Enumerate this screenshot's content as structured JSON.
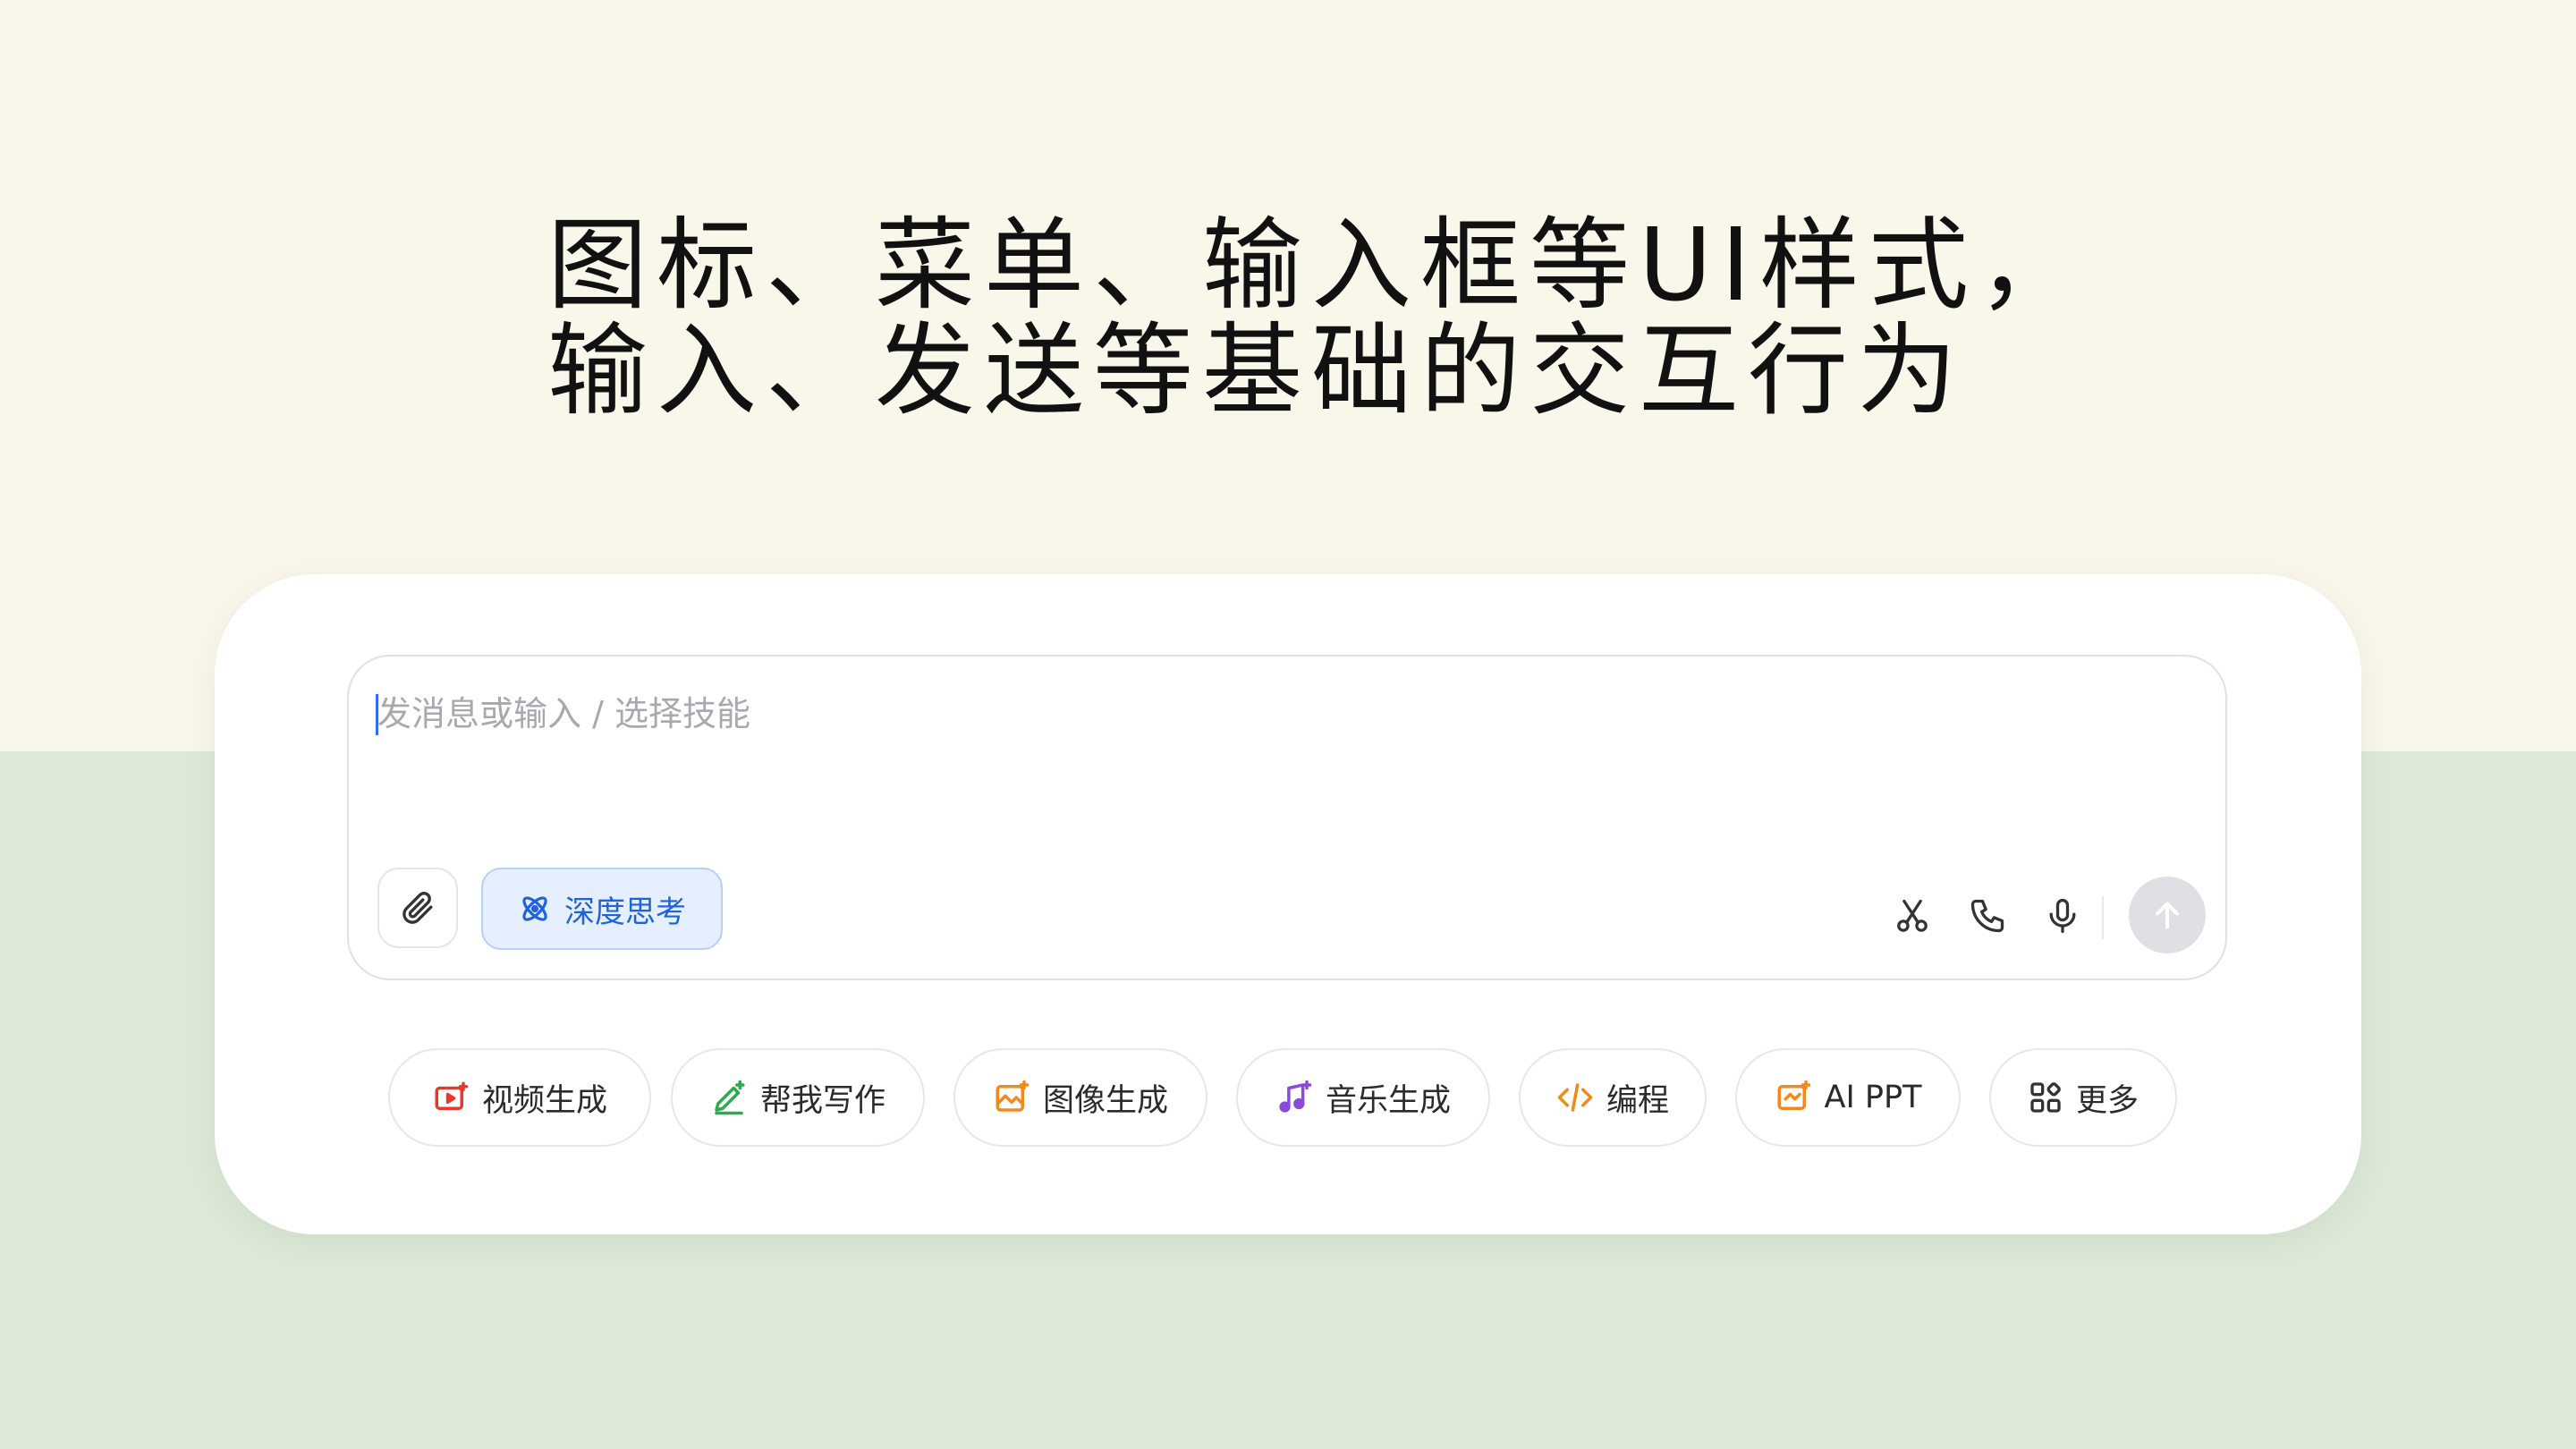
{
  "headline": {
    "line1": "图标、菜单、输入框等UI样式，",
    "line2": "输入、发送等基础的交互行为"
  },
  "composer": {
    "placeholder": "发消息或输入 / 选择技能",
    "deep_think_label": "深度思考"
  },
  "toolbar_icons": [
    "scissors-icon",
    "phone-icon",
    "microphone-icon",
    "send-arrow-icon",
    "paperclip-icon",
    "atom-icon"
  ],
  "skills": [
    {
      "label": "视频生成",
      "icon": "video-icon",
      "color": "#e8372b"
    },
    {
      "label": "帮我写作",
      "icon": "pen-sparkle-icon",
      "color": "#2fa84f"
    },
    {
      "label": "图像生成",
      "icon": "image-sparkle-icon",
      "color": "#f08a1c"
    },
    {
      "label": "音乐生成",
      "icon": "music-icon",
      "color": "#8a4bd8"
    },
    {
      "label": "编程",
      "icon": "code-icon",
      "color": "#f08a1c"
    },
    {
      "label": "AI PPT",
      "icon": "presentation-icon",
      "color": "#f08a1c"
    },
    {
      "label": "更多",
      "icon": "grid-icon",
      "color": "#333333"
    }
  ],
  "colors": {
    "background_top": "#f9f7ea",
    "background_bottom": "#dce9d6",
    "accent_blue": "#1f63db",
    "send_disabled": "#dfe0e3"
  }
}
